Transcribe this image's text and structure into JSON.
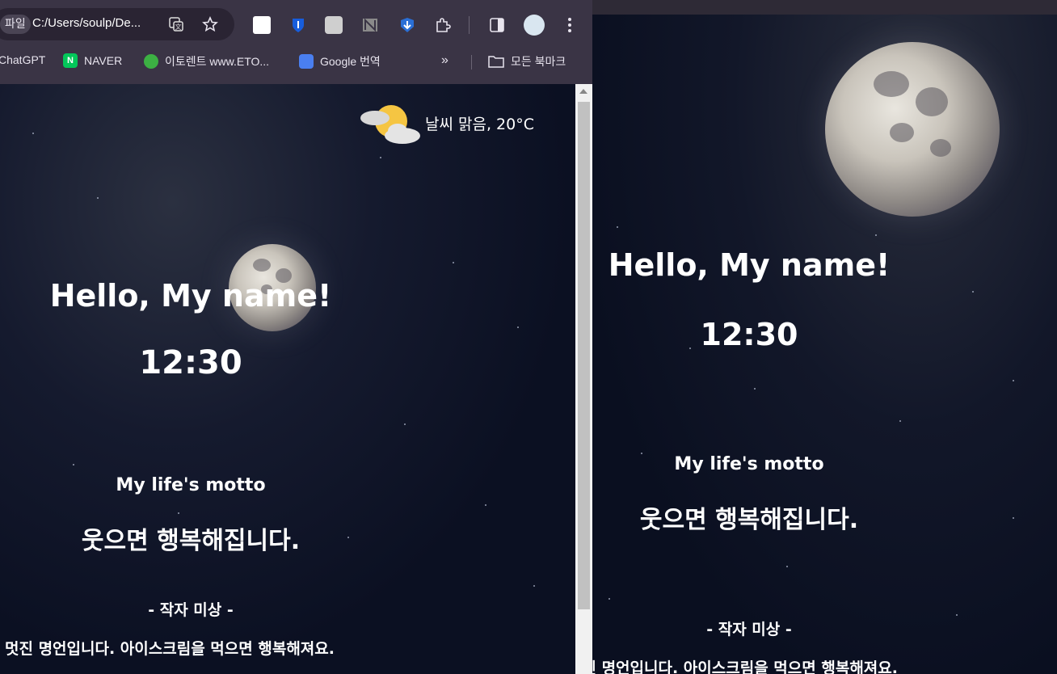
{
  "left_window": {
    "omnibox": {
      "file_chip": "파일",
      "url": "C:/Users/soulp/De..."
    },
    "bookmarks": [
      {
        "label": "ChatGPT",
        "icon": "chatgpt-icon"
      },
      {
        "label": "NAVER",
        "icon": "naver-icon",
        "color": "#03c75a"
      },
      {
        "label": "이토렌트 www.ETO...",
        "icon": "etorrent-icon",
        "color": "#3cb043"
      },
      {
        "label": "Google 번역",
        "icon": "google-translate-icon"
      }
    ],
    "bookmarks_overflow": "»",
    "all_bookmarks": "모든 북마크",
    "page": {
      "weather": "날씨 맑음, 20°C",
      "greeting": "Hello, My name!",
      "time": "12:30",
      "motto_label": "My life's motto",
      "motto": "웃으면 행복해집니다.",
      "author": "- 작자 미상 -",
      "comment": "멋진 명언입니다. 아이스크림을 먹으면 행복해져요."
    }
  },
  "right_window": {
    "page": {
      "greeting": "Hello, My name!",
      "time": "12:30",
      "motto_label": "My life's motto",
      "motto": "웃으면 행복해집니다.",
      "author": "- 작자 미상 -",
      "comment": "멋진 명언입니다. 아이스크림을 먹으면 행복해져요."
    }
  },
  "colors": {
    "chrome_bg": "#3a3445",
    "page_bg": "#0b1022",
    "text": "#ffffff"
  }
}
